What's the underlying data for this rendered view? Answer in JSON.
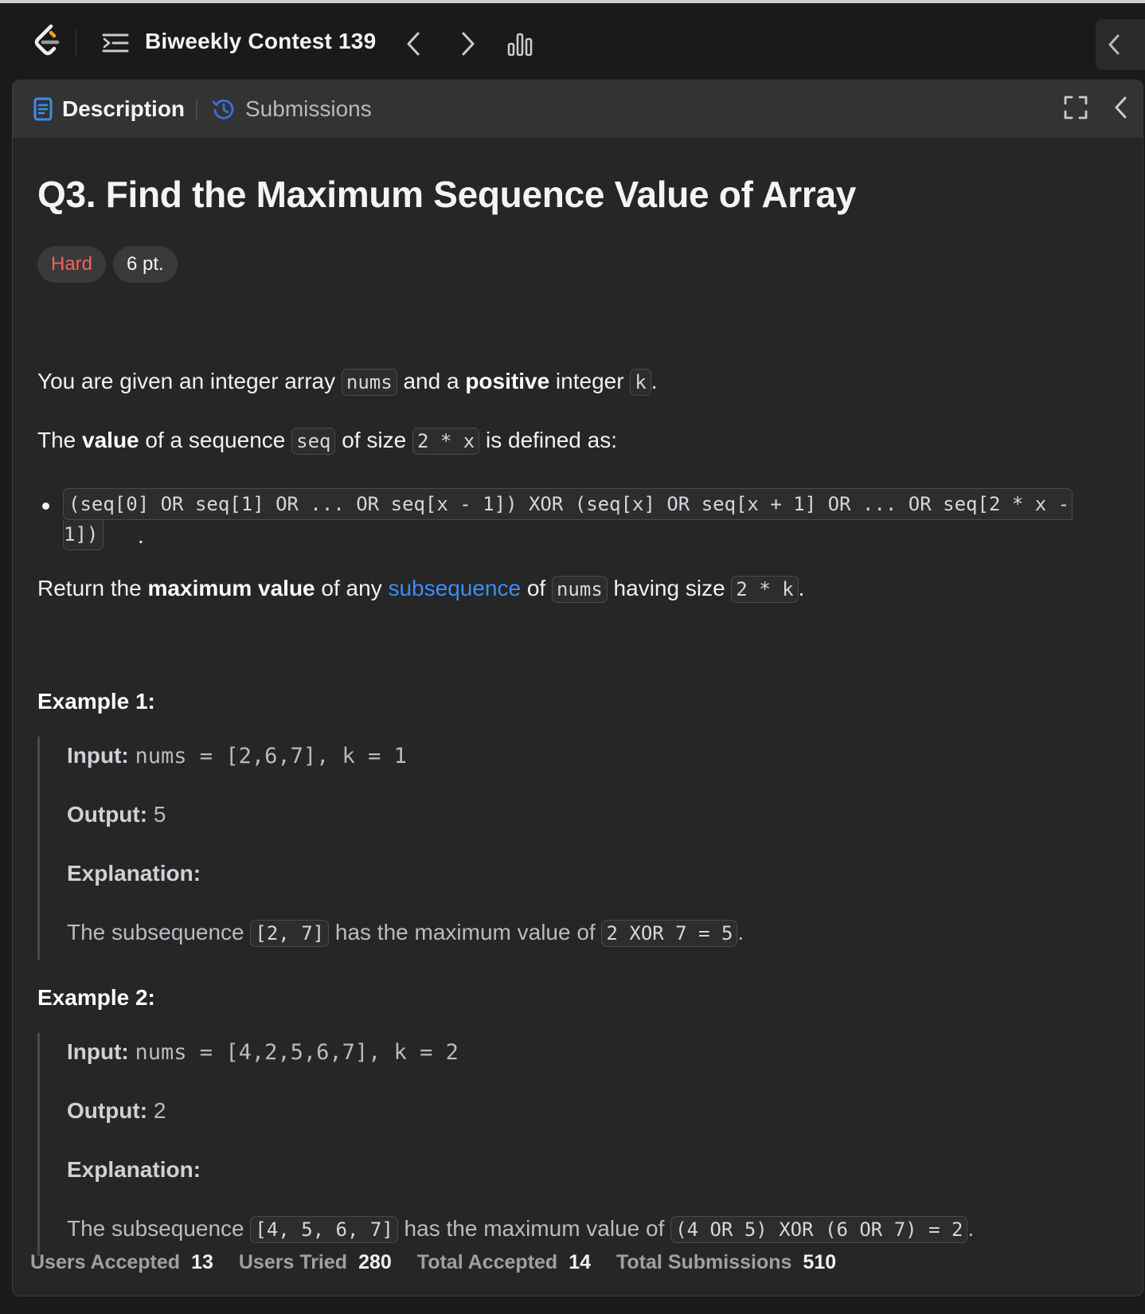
{
  "header": {
    "contest_title": "Biweekly Contest 139"
  },
  "tabs": {
    "description": "Description",
    "submissions": "Submissions"
  },
  "problem": {
    "title": "Q3. Find the Maximum Sequence Value of Array",
    "difficulty": "Hard",
    "points": "6 pt.",
    "p1": {
      "t1": "You are given an integer array ",
      "c1": "nums",
      "t2": " and a ",
      "b1": "positive",
      "t3": " integer ",
      "c2": "k",
      "t4": "."
    },
    "p2": {
      "t1": "The ",
      "b1": "value",
      "t2": " of a sequence ",
      "c1": "seq",
      "t3": " of size ",
      "c2": "2 * x",
      "t4": " is defined as:"
    },
    "bullet": {
      "line1": "(seq[0] OR seq[1] OR ... OR seq[x - 1]) XOR (seq[x] OR seq[x + 1] OR ... OR seq[2 * x -",
      "line2": "1])",
      "end": "."
    },
    "p3": {
      "t1": "Return the ",
      "b1": "maximum value",
      "t2": " of any ",
      "link": "subsequence",
      "t3": " of ",
      "c1": "nums",
      "t4": " having size ",
      "c2": "2 * k",
      "t5": "."
    }
  },
  "examples": [
    {
      "title": "Example 1:",
      "input_label": "Input:",
      "input_value": "nums = [2,6,7], k = 1",
      "output_label": "Output:",
      "output_value": "5",
      "explanation_label": "Explanation:",
      "exp": {
        "t1": "The subsequence ",
        "c1": "[2, 7]",
        "t2": " has the maximum value of ",
        "c2": "2 XOR 7 = 5",
        "t3": "."
      }
    },
    {
      "title": "Example 2:",
      "input_label": "Input:",
      "input_value": "nums = [4,2,5,6,7], k = 2",
      "output_label": "Output:",
      "output_value": "2",
      "explanation_label": "Explanation:",
      "exp": {
        "t1": "The subsequence ",
        "c1": "[4, 5, 6, 7]",
        "t2": " has the maximum value of ",
        "c2": "(4 OR 5) XOR (6 OR 7) = 2",
        "t3": "."
      }
    }
  ],
  "footer": {
    "users_accepted_label": "Users Accepted",
    "users_accepted": "13",
    "users_tried_label": "Users Tried",
    "users_tried": "280",
    "total_accepted_label": "Total Accepted",
    "total_accepted": "14",
    "total_submissions_label": "Total Submissions",
    "total_submissions": "510"
  },
  "icons": {
    "logo": "leetcode-logo",
    "list": "problem-list-icon",
    "prev": "chevron-left-icon",
    "next": "chevron-right-icon",
    "stats": "bar-chart-icon",
    "description": "document-icon",
    "submissions": "history-icon",
    "expand": "expand-icon",
    "collapse": "chevron-left-icon"
  },
  "colors": {
    "hard": "#f8615c",
    "link": "#3b8df2",
    "accent_doc": "#3b8df2"
  }
}
